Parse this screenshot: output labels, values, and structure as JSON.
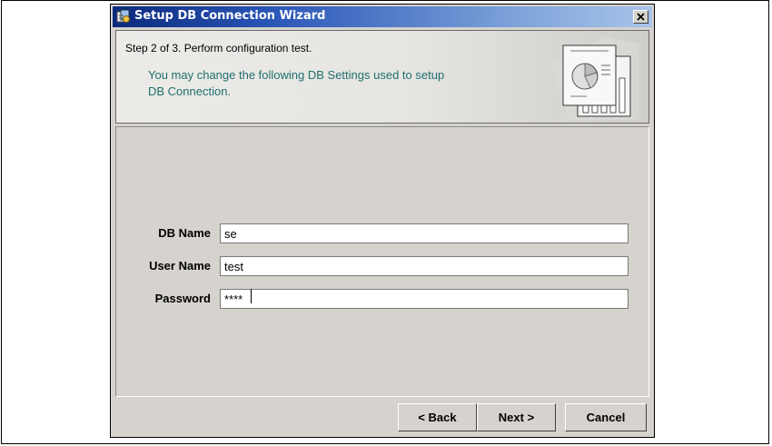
{
  "window": {
    "title": "Setup DB Connection Wizard"
  },
  "header": {
    "step_title": "Step 2 of 3. Perform configuration test.",
    "description": "You may change the following DB Settings used to setup DB Connection."
  },
  "form": {
    "fields": [
      {
        "label": "DB Name",
        "value": "se"
      },
      {
        "label": "User Name",
        "value": "test"
      },
      {
        "label": "Password",
        "value": "****"
      }
    ]
  },
  "buttons": {
    "back": "< Back",
    "next": "Next >",
    "cancel": "Cancel"
  },
  "colors": {
    "titlebar_start": "#0a2a7d",
    "titlebar_end": "#a8c4ea",
    "description_text": "#1f6f6f",
    "panel_background": "#d6d3ce"
  },
  "icons": {
    "title": "wizard-app-icon",
    "close": "close-icon",
    "header": "chart-report-illustration"
  }
}
